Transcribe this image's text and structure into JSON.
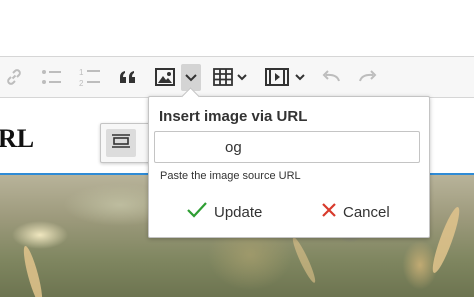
{
  "toolbar": {
    "items": [
      {
        "name": "link-button",
        "icon": "link-icon"
      },
      {
        "name": "bulleted-list-button",
        "icon": "bulleted-list-icon"
      },
      {
        "name": "numbered-list-button",
        "icon": "numbered-list-icon"
      },
      {
        "name": "block-quote-button",
        "icon": "quote-icon"
      },
      {
        "name": "insert-image-button",
        "icon": "image-icon"
      },
      {
        "name": "insert-image-dropdown-arrow",
        "icon": "chevron-down-icon"
      },
      {
        "name": "insert-table-button",
        "icon": "table-icon"
      },
      {
        "name": "insert-media-button",
        "icon": "media-icon"
      },
      {
        "name": "undo-button",
        "icon": "undo-icon"
      },
      {
        "name": "redo-button",
        "icon": "redo-icon"
      }
    ]
  },
  "editor": {
    "heading_fragment": "RL"
  },
  "image_toolbar": {
    "items": [
      {
        "name": "image-full-width-button",
        "icon": "image-full-icon"
      },
      {
        "name": "image-side-button",
        "icon": "image-side-icon"
      },
      {
        "name": "image-toggle-visibility-button",
        "icon": "eye-slash-icon"
      }
    ]
  },
  "balloon": {
    "title": "Insert image via URL",
    "input_value": "og",
    "hint": "Paste the image source URL",
    "update_label": "Update",
    "cancel_label": "Cancel"
  },
  "colors": {
    "accent": "#2f8bd6",
    "update_check": "#2e9e33",
    "cancel_x": "#d83a2c"
  }
}
